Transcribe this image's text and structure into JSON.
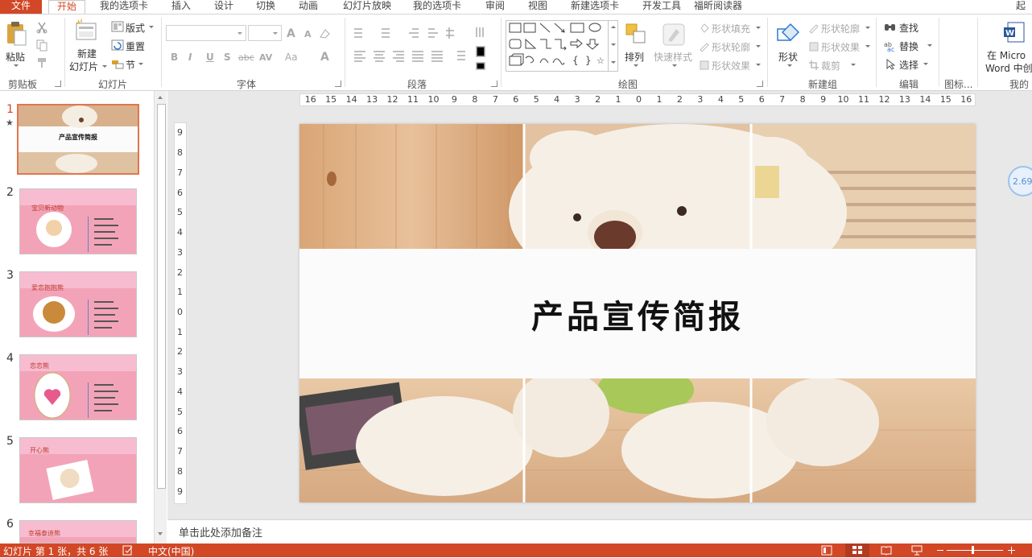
{
  "tabs": [
    "文件",
    "开始",
    "我的选项卡",
    "插入",
    "设计",
    "切换",
    "动画",
    "幻灯片放映",
    "我的选项卡",
    "审阅",
    "视图",
    "新建选项卡",
    "开发工具",
    "福昕阅读器",
    "起"
  ],
  "active_tab": "开始",
  "ribbon": {
    "clipboard": {
      "paste": "粘贴",
      "group": "剪贴板"
    },
    "slides": {
      "new_slide_1": "新建",
      "new_slide_2": "幻灯片",
      "layout": "版式",
      "reset": "重置",
      "section": "节",
      "group": "幻灯片"
    },
    "font": {
      "bold": "B",
      "italic": "I",
      "underline": "U",
      "shadow": "S",
      "strike": "abc",
      "spacing": "AV",
      "case": "Aa",
      "color": "A",
      "grow": "A",
      "shrink": "A",
      "group": "字体"
    },
    "paragraph": {
      "group": "段落"
    },
    "drawing": {
      "arrange": "排列",
      "quick_styles": "快速样式",
      "fill": "形状填充",
      "outline": "形状轮廓",
      "effects": "形状效果",
      "group": "绘图"
    },
    "newgroup": {
      "shape": "形状",
      "outline": "形状轮廓",
      "effects": "形状效果",
      "crop": "裁剪",
      "group": "新建组"
    },
    "editing": {
      "find": "查找",
      "replace": "替换",
      "select": "选择",
      "group": "编辑"
    },
    "icons": {
      "group": "图标..."
    },
    "mine": {
      "line1": "在 Micro",
      "line2": "Word 中创",
      "group": "我的文"
    }
  },
  "thumbnails": [
    {
      "num": "1",
      "title": "产品宣传简报",
      "active": true,
      "star": "★"
    },
    {
      "num": "2",
      "title": "宝贝新动物"
    },
    {
      "num": "3",
      "title": "爱恋抱抱熊"
    },
    {
      "num": "4",
      "title": "恋恋熊"
    },
    {
      "num": "5",
      "title": "开心熊"
    },
    {
      "num": "6",
      "title": "幸福泰迪熊"
    }
  ],
  "ruler": {
    "h": [
      "16",
      "15",
      "14",
      "13",
      "12",
      "11",
      "10",
      "9",
      "8",
      "7",
      "6",
      "5",
      "4",
      "3",
      "2",
      "1",
      "0",
      "1",
      "2",
      "3",
      "4",
      "5",
      "6",
      "7",
      "8",
      "9",
      "10",
      "11",
      "12",
      "13",
      "14",
      "15",
      "16"
    ],
    "v": [
      "9",
      "8",
      "7",
      "6",
      "5",
      "4",
      "3",
      "2",
      "1",
      "0",
      "1",
      "2",
      "3",
      "4",
      "5",
      "6",
      "7",
      "8",
      "9"
    ]
  },
  "slide": {
    "title": "产品宣传简报"
  },
  "badge": "2.69",
  "notes_placeholder": "单击此处添加备注",
  "status": {
    "slide_info": "幻灯片 第 1 张，共 6 张",
    "language": "中文(中国)"
  },
  "colors": {
    "accent": "#d24726",
    "thumb_pink": "#f3a3b8"
  }
}
